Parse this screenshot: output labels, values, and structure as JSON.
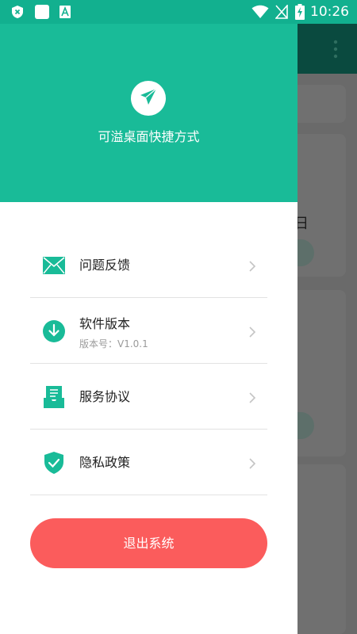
{
  "status_bar": {
    "time": "10:26",
    "icons": [
      "shield-x-icon",
      "square-notification-icon",
      "a-font-icon",
      "wifi-icon",
      "no-sim-icon",
      "battery-charging-icon"
    ]
  },
  "background_app": {
    "partial_text": "日",
    "menu_icon": "more-vert-icon"
  },
  "drawer": {
    "app_icon": "paper-plane-icon",
    "app_name": "可溢桌面快捷方式",
    "menu": [
      {
        "icon": "envelope-icon",
        "label": "问题反馈",
        "sub": ""
      },
      {
        "icon": "download-circle-icon",
        "label": "软件版本",
        "sub": "版本号：V1.0.1"
      },
      {
        "icon": "document-tray-icon",
        "label": "服务协议",
        "sub": ""
      },
      {
        "icon": "shield-check-icon",
        "label": "隐私政策",
        "sub": ""
      }
    ],
    "logout_label": "退出系统"
  },
  "colors": {
    "primary": "#19bb98",
    "logout": "#fb5c5c"
  }
}
